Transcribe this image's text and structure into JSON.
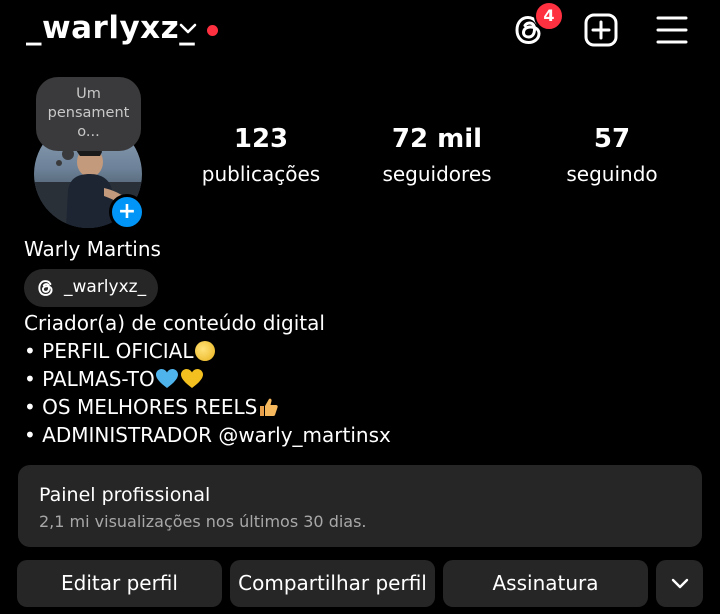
{
  "header": {
    "username": "_warlyxz_",
    "threads_badge_count": "4"
  },
  "profile": {
    "note": "Um pensament o...",
    "display_name": "Warly Martins",
    "threads_handle": "_warlyxz_",
    "stats": [
      {
        "value": "123",
        "label": "publicações"
      },
      {
        "value": "72 mil",
        "label": "seguidores"
      },
      {
        "value": "57",
        "label": "seguindo"
      }
    ],
    "bio": {
      "category": "Criador(a) de conteúdo digital",
      "line1": "• PERFIL OFICIAL",
      "line2": "• PALMAS-TO",
      "line3": "• OS MELHORES REELS",
      "line4": "• ADMINISTRADOR @warly_martinsx"
    }
  },
  "professional_panel": {
    "title": "Painel profissional",
    "subtitle": "2,1 mi visualizações nos últimos 30 dias."
  },
  "actions": {
    "edit": "Editar perfil",
    "share": "Compartilhar perfil",
    "subscription": "Assinatura"
  },
  "colors": {
    "background": "#000000",
    "surface": "#262626",
    "accent_blue": "#0095f6",
    "notification_red": "#ff3040"
  }
}
